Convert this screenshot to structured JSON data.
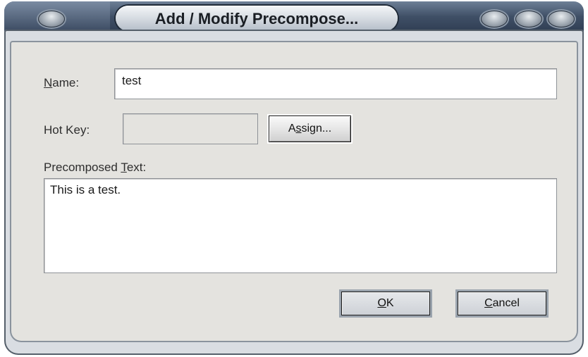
{
  "window": {
    "title": "Add / Modify Precompose..."
  },
  "form": {
    "name_label_prefix": "",
    "name_label_mnemonic": "N",
    "name_label_rest": "ame:",
    "name_value": "test",
    "hotkey_label": "Hot Key:",
    "hotkey_value": "",
    "assign_prefix": "A",
    "assign_mnemonic": "s",
    "assign_rest": "sign...",
    "text_label_prefix": "Precomposed ",
    "text_label_mnemonic": "T",
    "text_label_rest": "ext:",
    "text_value": "This is a test."
  },
  "buttons": {
    "ok_mnemonic": "O",
    "ok_rest": "K",
    "cancel_mnemonic": "C",
    "cancel_rest": "ancel"
  }
}
